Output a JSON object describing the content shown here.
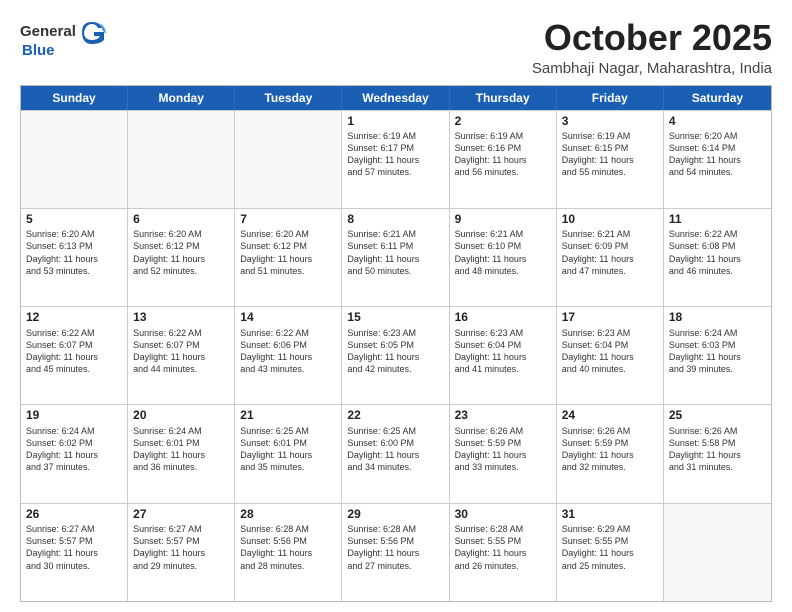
{
  "header": {
    "logo_general": "General",
    "logo_blue": "Blue",
    "month_title": "October 2025",
    "subtitle": "Sambhaji Nagar, Maharashtra, India"
  },
  "days_of_week": [
    "Sunday",
    "Monday",
    "Tuesday",
    "Wednesday",
    "Thursday",
    "Friday",
    "Saturday"
  ],
  "weeks": [
    [
      {
        "day": "",
        "empty": true
      },
      {
        "day": "",
        "empty": true
      },
      {
        "day": "",
        "empty": true
      },
      {
        "day": "1",
        "line1": "Sunrise: 6:19 AM",
        "line2": "Sunset: 6:17 PM",
        "line3": "Daylight: 11 hours",
        "line4": "and 57 minutes."
      },
      {
        "day": "2",
        "line1": "Sunrise: 6:19 AM",
        "line2": "Sunset: 6:16 PM",
        "line3": "Daylight: 11 hours",
        "line4": "and 56 minutes."
      },
      {
        "day": "3",
        "line1": "Sunrise: 6:19 AM",
        "line2": "Sunset: 6:15 PM",
        "line3": "Daylight: 11 hours",
        "line4": "and 55 minutes."
      },
      {
        "day": "4",
        "line1": "Sunrise: 6:20 AM",
        "line2": "Sunset: 6:14 PM",
        "line3": "Daylight: 11 hours",
        "line4": "and 54 minutes."
      }
    ],
    [
      {
        "day": "5",
        "line1": "Sunrise: 6:20 AM",
        "line2": "Sunset: 6:13 PM",
        "line3": "Daylight: 11 hours",
        "line4": "and 53 minutes."
      },
      {
        "day": "6",
        "line1": "Sunrise: 6:20 AM",
        "line2": "Sunset: 6:12 PM",
        "line3": "Daylight: 11 hours",
        "line4": "and 52 minutes."
      },
      {
        "day": "7",
        "line1": "Sunrise: 6:20 AM",
        "line2": "Sunset: 6:12 PM",
        "line3": "Daylight: 11 hours",
        "line4": "and 51 minutes."
      },
      {
        "day": "8",
        "line1": "Sunrise: 6:21 AM",
        "line2": "Sunset: 6:11 PM",
        "line3": "Daylight: 11 hours",
        "line4": "and 50 minutes."
      },
      {
        "day": "9",
        "line1": "Sunrise: 6:21 AM",
        "line2": "Sunset: 6:10 PM",
        "line3": "Daylight: 11 hours",
        "line4": "and 48 minutes."
      },
      {
        "day": "10",
        "line1": "Sunrise: 6:21 AM",
        "line2": "Sunset: 6:09 PM",
        "line3": "Daylight: 11 hours",
        "line4": "and 47 minutes."
      },
      {
        "day": "11",
        "line1": "Sunrise: 6:22 AM",
        "line2": "Sunset: 6:08 PM",
        "line3": "Daylight: 11 hours",
        "line4": "and 46 minutes."
      }
    ],
    [
      {
        "day": "12",
        "line1": "Sunrise: 6:22 AM",
        "line2": "Sunset: 6:07 PM",
        "line3": "Daylight: 11 hours",
        "line4": "and 45 minutes."
      },
      {
        "day": "13",
        "line1": "Sunrise: 6:22 AM",
        "line2": "Sunset: 6:07 PM",
        "line3": "Daylight: 11 hours",
        "line4": "and 44 minutes."
      },
      {
        "day": "14",
        "line1": "Sunrise: 6:22 AM",
        "line2": "Sunset: 6:06 PM",
        "line3": "Daylight: 11 hours",
        "line4": "and 43 minutes."
      },
      {
        "day": "15",
        "line1": "Sunrise: 6:23 AM",
        "line2": "Sunset: 6:05 PM",
        "line3": "Daylight: 11 hours",
        "line4": "and 42 minutes."
      },
      {
        "day": "16",
        "line1": "Sunrise: 6:23 AM",
        "line2": "Sunset: 6:04 PM",
        "line3": "Daylight: 11 hours",
        "line4": "and 41 minutes."
      },
      {
        "day": "17",
        "line1": "Sunrise: 6:23 AM",
        "line2": "Sunset: 6:04 PM",
        "line3": "Daylight: 11 hours",
        "line4": "and 40 minutes."
      },
      {
        "day": "18",
        "line1": "Sunrise: 6:24 AM",
        "line2": "Sunset: 6:03 PM",
        "line3": "Daylight: 11 hours",
        "line4": "and 39 minutes."
      }
    ],
    [
      {
        "day": "19",
        "line1": "Sunrise: 6:24 AM",
        "line2": "Sunset: 6:02 PM",
        "line3": "Daylight: 11 hours",
        "line4": "and 37 minutes."
      },
      {
        "day": "20",
        "line1": "Sunrise: 6:24 AM",
        "line2": "Sunset: 6:01 PM",
        "line3": "Daylight: 11 hours",
        "line4": "and 36 minutes."
      },
      {
        "day": "21",
        "line1": "Sunrise: 6:25 AM",
        "line2": "Sunset: 6:01 PM",
        "line3": "Daylight: 11 hours",
        "line4": "and 35 minutes."
      },
      {
        "day": "22",
        "line1": "Sunrise: 6:25 AM",
        "line2": "Sunset: 6:00 PM",
        "line3": "Daylight: 11 hours",
        "line4": "and 34 minutes."
      },
      {
        "day": "23",
        "line1": "Sunrise: 6:26 AM",
        "line2": "Sunset: 5:59 PM",
        "line3": "Daylight: 11 hours",
        "line4": "and 33 minutes."
      },
      {
        "day": "24",
        "line1": "Sunrise: 6:26 AM",
        "line2": "Sunset: 5:59 PM",
        "line3": "Daylight: 11 hours",
        "line4": "and 32 minutes."
      },
      {
        "day": "25",
        "line1": "Sunrise: 6:26 AM",
        "line2": "Sunset: 5:58 PM",
        "line3": "Daylight: 11 hours",
        "line4": "and 31 minutes."
      }
    ],
    [
      {
        "day": "26",
        "line1": "Sunrise: 6:27 AM",
        "line2": "Sunset: 5:57 PM",
        "line3": "Daylight: 11 hours",
        "line4": "and 30 minutes."
      },
      {
        "day": "27",
        "line1": "Sunrise: 6:27 AM",
        "line2": "Sunset: 5:57 PM",
        "line3": "Daylight: 11 hours",
        "line4": "and 29 minutes."
      },
      {
        "day": "28",
        "line1": "Sunrise: 6:28 AM",
        "line2": "Sunset: 5:56 PM",
        "line3": "Daylight: 11 hours",
        "line4": "and 28 minutes."
      },
      {
        "day": "29",
        "line1": "Sunrise: 6:28 AM",
        "line2": "Sunset: 5:56 PM",
        "line3": "Daylight: 11 hours",
        "line4": "and 27 minutes."
      },
      {
        "day": "30",
        "line1": "Sunrise: 6:28 AM",
        "line2": "Sunset: 5:55 PM",
        "line3": "Daylight: 11 hours",
        "line4": "and 26 minutes."
      },
      {
        "day": "31",
        "line1": "Sunrise: 6:29 AM",
        "line2": "Sunset: 5:55 PM",
        "line3": "Daylight: 11 hours",
        "line4": "and 25 minutes."
      },
      {
        "day": "",
        "empty": true
      }
    ]
  ]
}
